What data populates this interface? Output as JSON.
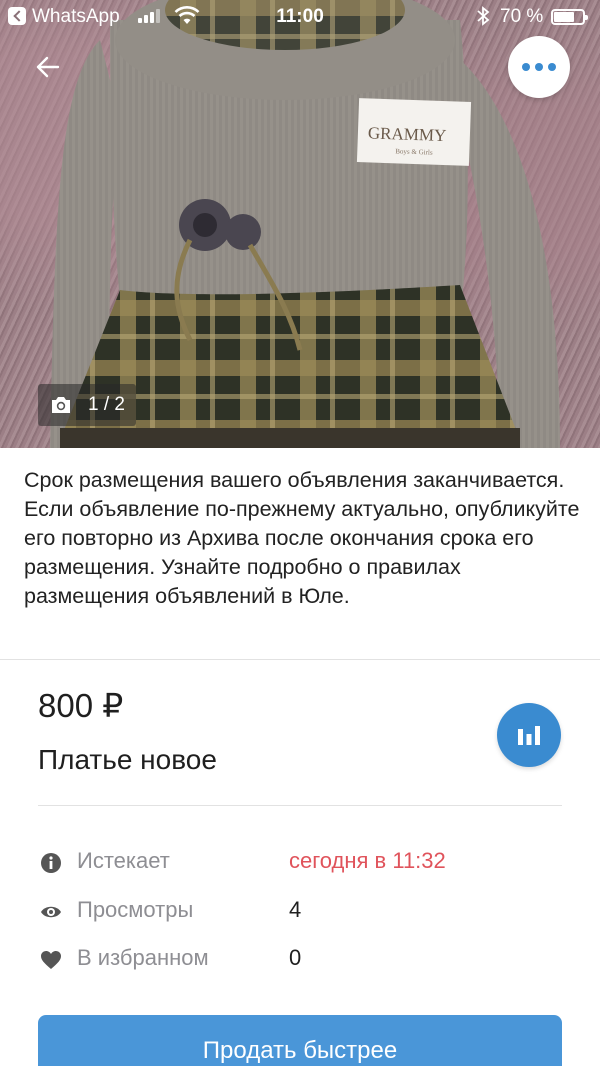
{
  "status_bar": {
    "app": "WhatsApp",
    "time": "11:00",
    "battery": "70 %"
  },
  "photo": {
    "counter": "1 / 2",
    "brand_tag": "GRAMMY",
    "brand_tag_sub": "Boys & Girls"
  },
  "notice": "Срок размещения вашего объявления заканчивается. Если объявление по-прежнему актуально, опубликуйте его повторно из Архива после окончания срока его размещения. Узнайте подробно о правилах размещения объявлений в Юле.",
  "listing": {
    "price": "800 ₽",
    "title": "Платье новое"
  },
  "info": [
    {
      "icon": "info-icon",
      "label": "Истекает",
      "value": "сегодня в 11:32",
      "value_color": "#e0535b"
    },
    {
      "icon": "eye-icon",
      "label": "Просмотры",
      "value": "4"
    },
    {
      "icon": "heart-icon",
      "label": "В избранном",
      "value": "0"
    }
  ],
  "actions": {
    "sell_faster": "Продать быстрее"
  },
  "colors": {
    "accent": "#3a8bd0",
    "button": "#4a96d8",
    "expiry": "#e0535b",
    "muted": "#8e8e93"
  }
}
